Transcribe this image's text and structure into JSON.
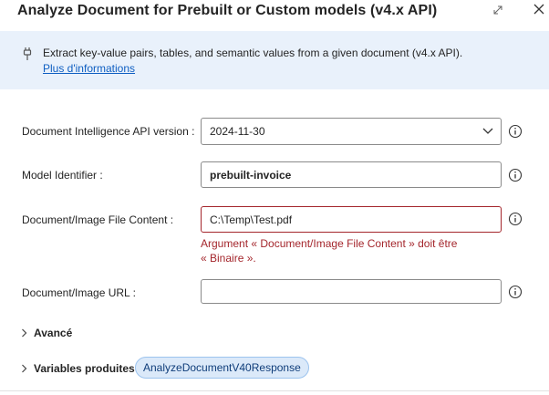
{
  "dialog": {
    "title": "Analyze Document for Prebuilt or Custom models (v4.x API)"
  },
  "banner": {
    "description": "Extract key-value pairs, tables, and semantic values from a given document (v4.x API).",
    "link": "Plus d'informations"
  },
  "fields": {
    "api_version": {
      "label": "Document Intelligence API version :",
      "value": "2024-11-30"
    },
    "model_id": {
      "label": "Model Identifier :",
      "value": "prebuilt-invoice"
    },
    "file_content": {
      "label": "Document/Image File Content :",
      "value": "C:\\Temp\\Test.pdf",
      "error_line1": "Argument « Document/Image File Content » doit être",
      "error_line2": "« Binaire »."
    },
    "image_url": {
      "label": "Document/Image URL :",
      "value": ""
    }
  },
  "sections": {
    "advanced": "Avancé",
    "produced_vars": "Variables produites",
    "var_name": "AnalyzeDocumentV40Response"
  },
  "icons": {
    "expand": "expand-icon",
    "close": "close-icon",
    "plug": "plug-icon",
    "help": "info-circle-icon",
    "dropdown": "chevron-down-icon",
    "expander": "chevron-right-icon"
  },
  "colors": {
    "banner_bg": "#e9f1fb",
    "link": "#0f5fc2",
    "error": "#a4262c",
    "chip_bg": "#dbe9f9"
  }
}
